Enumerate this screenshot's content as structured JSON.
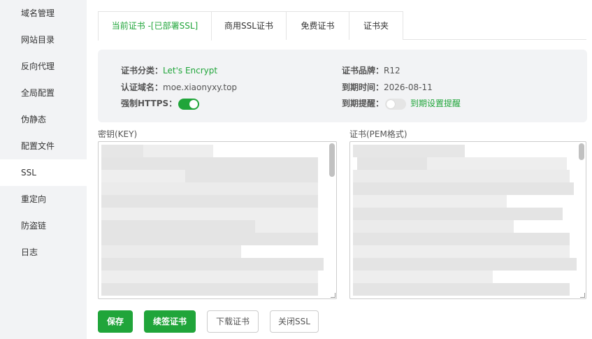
{
  "sidebar": {
    "items": [
      {
        "label": "域名管理"
      },
      {
        "label": "网站目录"
      },
      {
        "label": "反向代理"
      },
      {
        "label": "全局配置"
      },
      {
        "label": "伪静态"
      },
      {
        "label": "配置文件"
      },
      {
        "label": "SSL"
      },
      {
        "label": "重定向"
      },
      {
        "label": "防盗链"
      },
      {
        "label": "日志"
      }
    ],
    "active": "SSL"
  },
  "tabs": [
    {
      "label": "当前证书 -[已部署SSL]"
    },
    {
      "label": "商用SSL证书"
    },
    {
      "label": "免费证书"
    },
    {
      "label": "证书夹"
    }
  ],
  "cert_info": {
    "category_label": "证书分类：",
    "category_value": "Let's Encrypt",
    "domain_label": "认证域名：",
    "domain_value": "moe.xiaonyxy.top",
    "force_https_label": "强制HTTPS：",
    "force_https_on": true,
    "brand_label": "证书品牌：",
    "brand_value": "R12",
    "expire_label": "到期时间：",
    "expire_value": "2026-08-11",
    "remind_label": "到期提醒：",
    "remind_on": false,
    "remind_link": "到期设置提醒"
  },
  "key_field": {
    "label": "密钥(KEY)"
  },
  "cert_field": {
    "label": "证书(PEM格式)"
  },
  "buttons": {
    "save": "保存",
    "renew": "续签证书",
    "download": "下载证书",
    "close_ssl": "关闭SSL"
  },
  "colors": {
    "accent": "#20a53a",
    "sidebar_bg": "#f2f3f5",
    "info_bg": "#f2f3f5"
  }
}
